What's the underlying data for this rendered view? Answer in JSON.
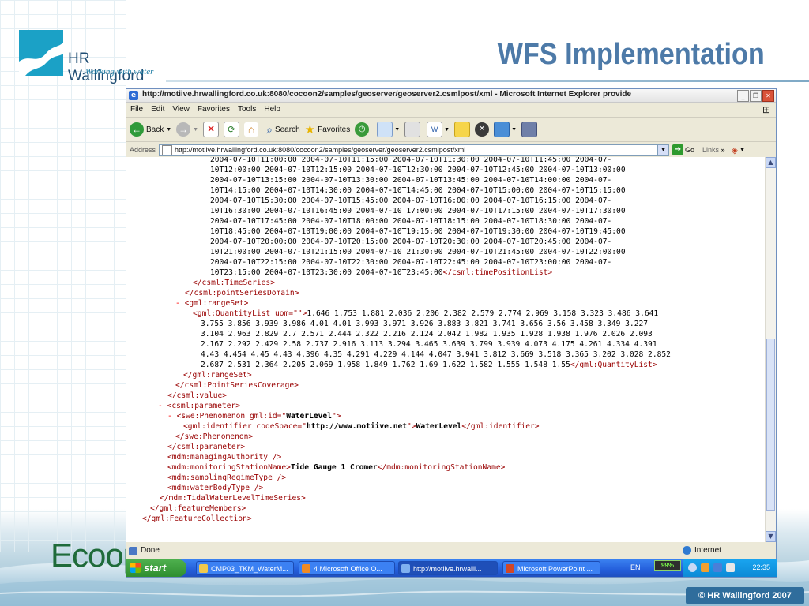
{
  "slide": {
    "title": "WFS Implementation",
    "logo_brand": "HR Wallingford",
    "logo_tagline": "Working with water",
    "footer_logo_text": "Ecoop",
    "copyright": "© HR Wallingford 2007"
  },
  "browser": {
    "window_title": "http://motiive.hrwallingford.co.uk:8080/cocoon2/samples/geoserver/geoserver2.csmlpost/xml - Microsoft Internet Explorer provide",
    "menu": [
      "File",
      "Edit",
      "View",
      "Favorites",
      "Tools",
      "Help"
    ],
    "toolbar": {
      "back": "Back",
      "search": "Search",
      "favorites": "Favorites"
    },
    "address_label": "Address",
    "address_value": "http://motiive.hrwallingford.co.uk:8080/cocoon2/samples/geoserver/geoserver2.csmlpost/xml",
    "go_label": "Go",
    "links_label": "Links",
    "status_text": "Done",
    "status_zone": "Internet"
  },
  "xml": {
    "time_lines": [
      "2004-07-10T11:00:00 2004-07-10T11:15:00 2004-07-10T11:30:00 2004-07-10T11:45:00 2004-07-",
      "10T12:00:00 2004-07-10T12:15:00 2004-07-10T12:30:00 2004-07-10T12:45:00 2004-07-10T13:00:00",
      "2004-07-10T13:15:00 2004-07-10T13:30:00 2004-07-10T13:45:00 2004-07-10T14:00:00 2004-07-",
      "10T14:15:00 2004-07-10T14:30:00 2004-07-10T14:45:00 2004-07-10T15:00:00 2004-07-10T15:15:00",
      "2004-07-10T15:30:00 2004-07-10T15:45:00 2004-07-10T16:00:00 2004-07-10T16:15:00 2004-07-",
      "10T16:30:00 2004-07-10T16:45:00 2004-07-10T17:00:00 2004-07-10T17:15:00 2004-07-10T17:30:00",
      "2004-07-10T17:45:00 2004-07-10T18:00:00 2004-07-10T18:15:00 2004-07-10T18:30:00 2004-07-",
      "10T18:45:00 2004-07-10T19:00:00 2004-07-10T19:15:00 2004-07-10T19:30:00 2004-07-10T19:45:00",
      "2004-07-10T20:00:00 2004-07-10T20:15:00 2004-07-10T20:30:00 2004-07-10T20:45:00 2004-07-",
      "10T21:00:00 2004-07-10T21:15:00 2004-07-10T21:30:00 2004-07-10T21:45:00 2004-07-10T22:00:00",
      "2004-07-10T22:15:00 2004-07-10T22:30:00 2004-07-10T22:45:00 2004-07-10T23:00:00 2004-07-"
    ],
    "time_last": "10T23:15:00 2004-07-10T23:30:00 2004-07-10T23:45:00",
    "time_close": "</csml:timePositionList>",
    "l_timeseries_close": "</csml:TimeSeries>",
    "l_pointseriesdomain_close": "</csml:pointSeriesDomain>",
    "l_rangeset_open": "<gml:rangeSet>",
    "l_quantitylist_open": "<gml:QuantityList uom=\"\">",
    "quantity_first": "1.646 1.753 1.881 2.036 2.206 2.382 2.579 2.774 2.969 3.158 3.323 3.486 3.641",
    "quantity_lines": [
      "3.755 3.856 3.939 3.986 4.01 4.01 3.993 3.971 3.926 3.883 3.821 3.741 3.656 3.56 3.458 3.349 3.227",
      "3.104 2.963 2.829 2.7 2.571 2.444 2.322 2.216 2.124 2.042 1.982 1.935 1.928 1.938 1.976 2.026 2.093",
      "2.167 2.292 2.429 2.58 2.737 2.916 3.113 3.294 3.465 3.639 3.799 3.939 4.073 4.175 4.261 4.334 4.391",
      "4.43 4.454 4.45 4.43 4.396 4.35 4.291 4.229 4.144 4.047 3.941 3.812 3.669 3.518 3.365 3.202 3.028 2.852"
    ],
    "quantity_last": "2.687 2.531 2.364 2.205 2.069 1.958 1.849 1.762 1.69 1.622 1.582 1.555 1.548 1.55",
    "quantity_close": "</gml:QuantityList>",
    "l_rangeset_close": "</gml:rangeSet>",
    "l_pointseriescoverage_close": "</csml:PointSeriesCoverage>",
    "l_value_close": "</csml:value>",
    "l_parameter_open": "<csml:parameter>",
    "l_phenomenon_open_a": "<swe:Phenomenon gml:id=\"",
    "l_phenomenon_id": "WaterLevel",
    "l_phenomenon_open_b": "\">",
    "l_identifier_open_a": "<gml:identifier codeSpace=\"",
    "l_identifier_codespace": "http://www.motiive.net",
    "l_identifier_open_b": "\">",
    "l_identifier_value": "WaterLevel",
    "l_identifier_close": "</gml:identifier>",
    "l_phenomenon_close": "</swe:Phenomenon>",
    "l_parameter_close": "</csml:parameter>",
    "l_managing": "<mdm:managingAuthority />",
    "l_station_open": "<mdm:monitoringStationName>",
    "l_station_value": "Tide Gauge 1 Cromer",
    "l_station_close": "</mdm:monitoringStationName>",
    "l_sampling": "<mdm:samplingRegimeType />",
    "l_waterbody": "<mdm:waterBodyType />",
    "l_tidal_close": "</mdm:TidalWaterLevelTimeSeries>",
    "l_featuremembers_close": "</gml:featureMembers>",
    "l_featurecollection_close": "</gml:FeatureCollection>",
    "minus": "-"
  },
  "taskbar": {
    "start_label": "start",
    "tasks": [
      "CMP03_TKM_WaterM...",
      "4 Microsoft Office O...",
      "http://motiive.hrwalli...",
      "Microsoft PowerPoint ..."
    ],
    "language": "EN",
    "battery": "99%",
    "clock": "22:35"
  }
}
